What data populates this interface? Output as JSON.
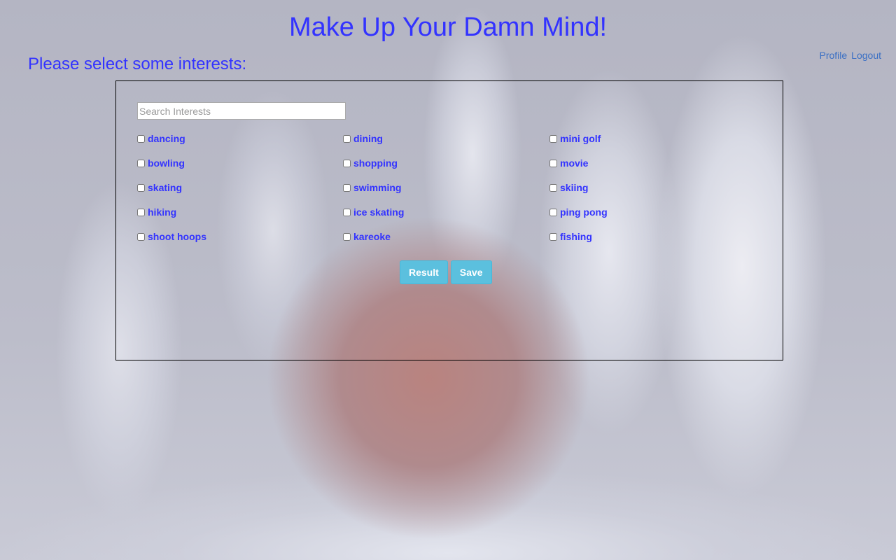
{
  "header": {
    "title": "Make Up Your Damn Mind!",
    "subtitle": "Please select some interests:"
  },
  "nav": {
    "profile": "Profile",
    "logout": "Logout"
  },
  "search": {
    "placeholder": "Search Interests",
    "value": ""
  },
  "interests": [
    "dancing",
    "dining",
    "mini golf",
    "bowling",
    "shopping",
    "movie",
    "skating",
    "swimming",
    "skiing",
    "hiking",
    "ice skating",
    "ping pong",
    "shoot hoops",
    "kareoke",
    "fishing"
  ],
  "actions": {
    "result": "Result",
    "save": "Save"
  },
  "colors": {
    "heading": "#3333ff",
    "link": "#3a6fc4",
    "button": "#5bc0de"
  }
}
